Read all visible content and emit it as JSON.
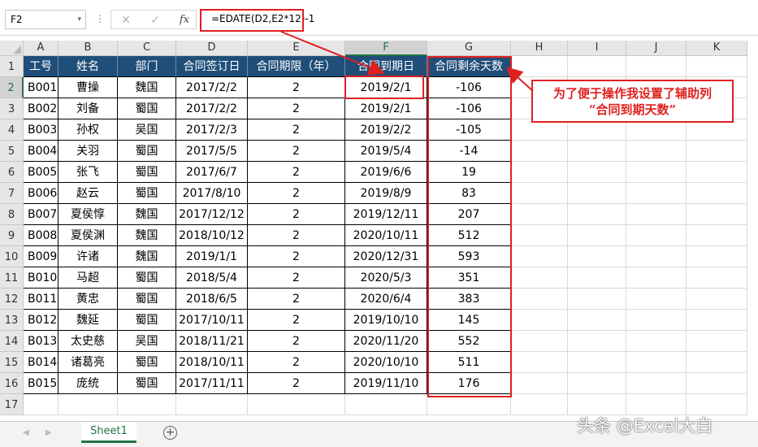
{
  "formula_bar": {
    "name_box": "F2",
    "name_box_caret": "▾",
    "dots": "⋮",
    "cancel_glyph": "✕",
    "enter_glyph": "✓",
    "fx_label": "fx",
    "formula": "=EDATE(D2,E2*12)-1"
  },
  "columns": [
    "A",
    "B",
    "C",
    "D",
    "E",
    "F",
    "G",
    "H",
    "I",
    "J",
    "K"
  ],
  "rows": [
    "1",
    "2",
    "3",
    "4",
    "5",
    "6",
    "7",
    "8",
    "9",
    "10",
    "11",
    "12",
    "13",
    "14",
    "15",
    "16",
    "17"
  ],
  "table": {
    "headers": [
      "工号",
      "姓名",
      "部门",
      "合同签订日",
      "合同期限（年）",
      "合同到期日",
      "合同剩余天数"
    ],
    "rows": [
      [
        "B001",
        "曹操",
        "魏国",
        "2017/2/2",
        "2",
        "2019/2/1",
        "-106"
      ],
      [
        "B002",
        "刘备",
        "蜀国",
        "2017/2/2",
        "2",
        "2019/2/1",
        "-106"
      ],
      [
        "B003",
        "孙权",
        "吴国",
        "2017/2/3",
        "2",
        "2019/2/2",
        "-105"
      ],
      [
        "B004",
        "关羽",
        "蜀国",
        "2017/5/5",
        "2",
        "2019/5/4",
        "-14"
      ],
      [
        "B005",
        "张飞",
        "蜀国",
        "2017/6/7",
        "2",
        "2019/6/6",
        "19"
      ],
      [
        "B006",
        "赵云",
        "蜀国",
        "2017/8/10",
        "2",
        "2019/8/9",
        "83"
      ],
      [
        "B007",
        "夏侯惇",
        "魏国",
        "2017/12/12",
        "2",
        "2019/12/11",
        "207"
      ],
      [
        "B008",
        "夏侯渊",
        "魏国",
        "2018/10/12",
        "2",
        "2020/10/11",
        "512"
      ],
      [
        "B009",
        "许诸",
        "魏国",
        "2019/1/1",
        "2",
        "2020/12/31",
        "593"
      ],
      [
        "B010",
        "马超",
        "蜀国",
        "2018/5/4",
        "2",
        "2020/5/3",
        "351"
      ],
      [
        "B011",
        "黄忠",
        "蜀国",
        "2018/6/5",
        "2",
        "2020/6/4",
        "383"
      ],
      [
        "B012",
        "魏延",
        "蜀国",
        "2017/10/11",
        "2",
        "2019/10/10",
        "145"
      ],
      [
        "B013",
        "太史慈",
        "吴国",
        "2018/11/21",
        "2",
        "2020/11/20",
        "552"
      ],
      [
        "B014",
        "诸葛亮",
        "蜀国",
        "2018/10/11",
        "2",
        "2020/10/10",
        "511"
      ],
      [
        "B015",
        "庞统",
        "蜀国",
        "2017/11/11",
        "2",
        "2019/11/10",
        "176"
      ]
    ]
  },
  "callout": {
    "line1": "为了便于操作我设置了辅助列",
    "line2": "“合同到期天数”"
  },
  "sheet_bar": {
    "prev_glyph": "◀",
    "next_glyph": "▶",
    "tab": "Sheet1",
    "add_glyph": "+"
  },
  "watermark": "头条 @Excel大白",
  "colors": {
    "header_fill": "#1f4e79",
    "annotation_red": "#e02020",
    "excel_green": "#217346"
  }
}
